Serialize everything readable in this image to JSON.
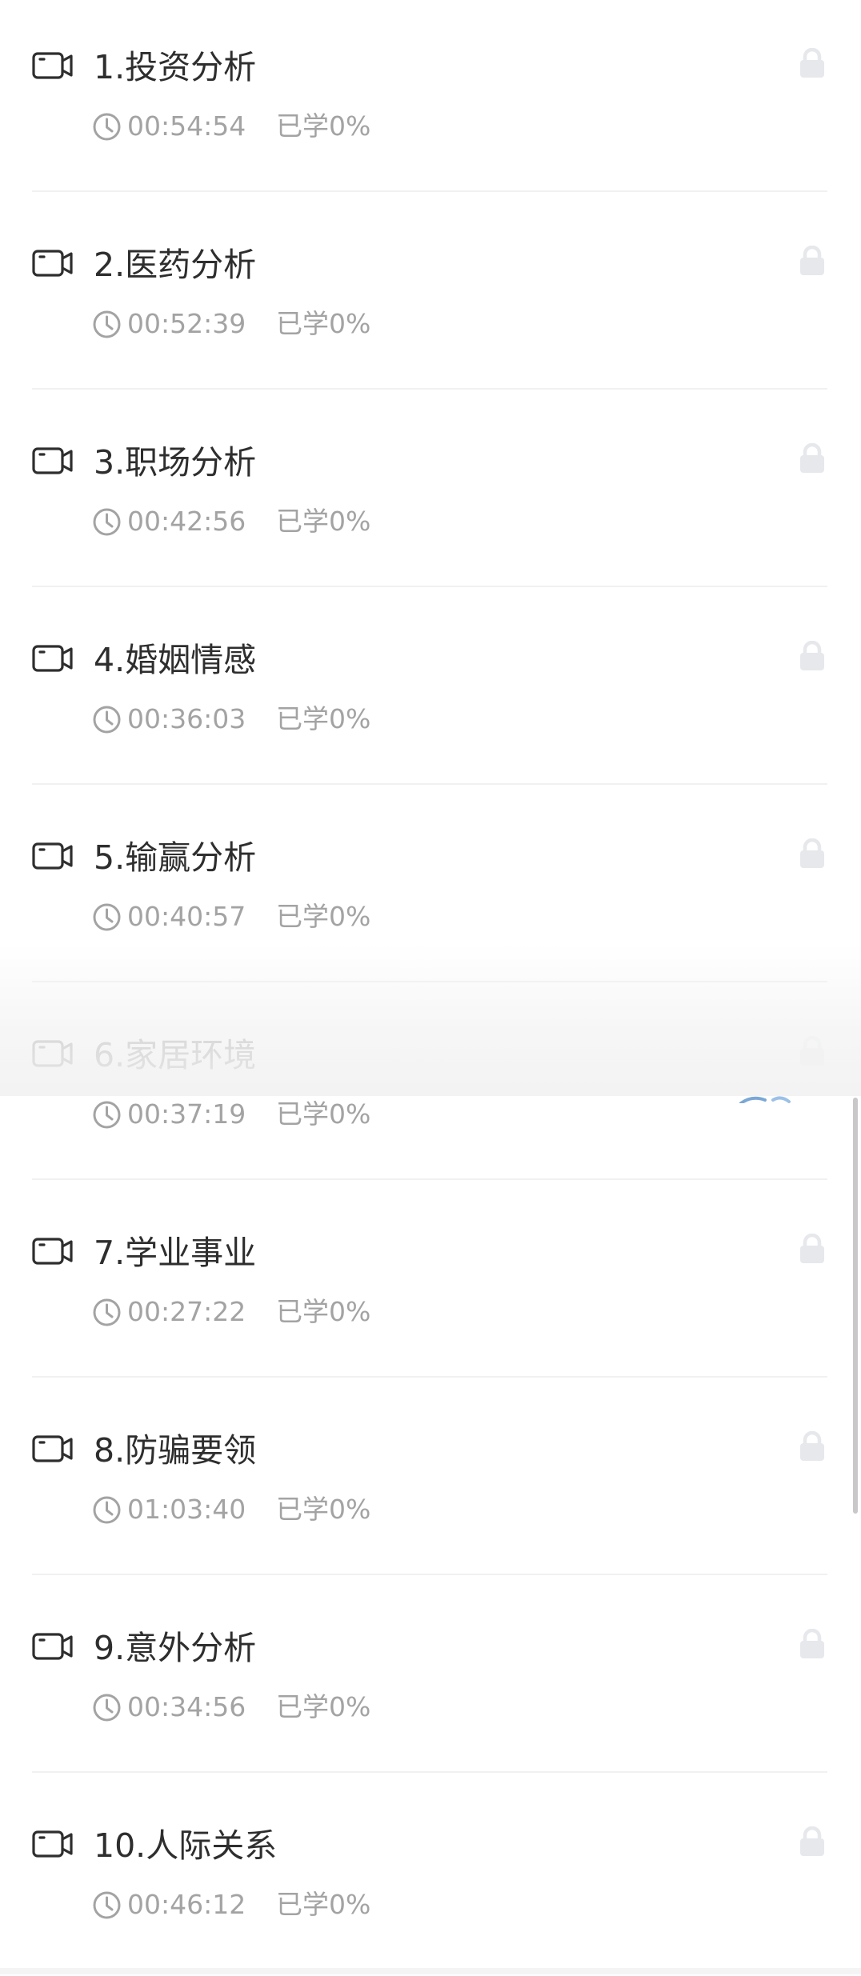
{
  "lessons": [
    {
      "title": "1.投资分析",
      "duration": "00:54:54",
      "progress": "已学0%"
    },
    {
      "title": "2.医药分析",
      "duration": "00:52:39",
      "progress": "已学0%"
    },
    {
      "title": "3.职场分析",
      "duration": "00:42:56",
      "progress": "已学0%"
    },
    {
      "title": "4.婚姻情感",
      "duration": "00:36:03",
      "progress": "已学0%"
    },
    {
      "title": "5.输赢分析",
      "duration": "00:40:57",
      "progress": "已学0%"
    },
    {
      "title": "6.家居环境",
      "duration": "00:37:19",
      "progress": "已学0%"
    },
    {
      "title": "7.学业事业",
      "duration": "00:27:22",
      "progress": "已学0%"
    },
    {
      "title": "8.防骗要领",
      "duration": "01:03:40",
      "progress": "已学0%"
    },
    {
      "title": "9.意外分析",
      "duration": "00:34:56",
      "progress": "已学0%"
    },
    {
      "title": "10.人际关系",
      "duration": "00:46:12",
      "progress": "已学0%"
    }
  ],
  "icons": {
    "video": "video-camera-icon",
    "clock": "clock-icon",
    "lock": "lock-icon"
  },
  "colors": {
    "title_text": "#2e2e2e",
    "meta_text": "#a3a3a3",
    "lock": "#e6e8ec",
    "divider": "#f1f1f1"
  }
}
